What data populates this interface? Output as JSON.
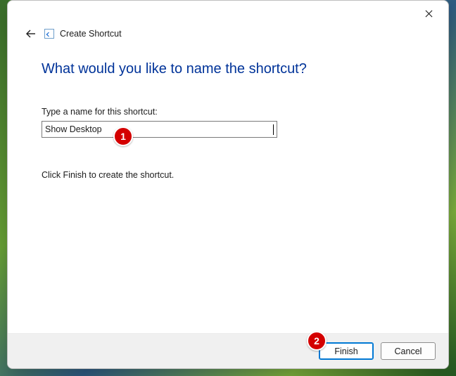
{
  "titlebar": {
    "close_title": "Close"
  },
  "header": {
    "wizard_title": "Create Shortcut"
  },
  "main": {
    "heading": "What would you like to name the shortcut?",
    "field_label": "Type a name for this shortcut:",
    "name_value": "Show Desktop",
    "instruction": "Click Finish to create the shortcut."
  },
  "footer": {
    "finish_label": "Finish",
    "cancel_label": "Cancel"
  },
  "annotations": {
    "badge1": "1",
    "badge2": "2"
  }
}
